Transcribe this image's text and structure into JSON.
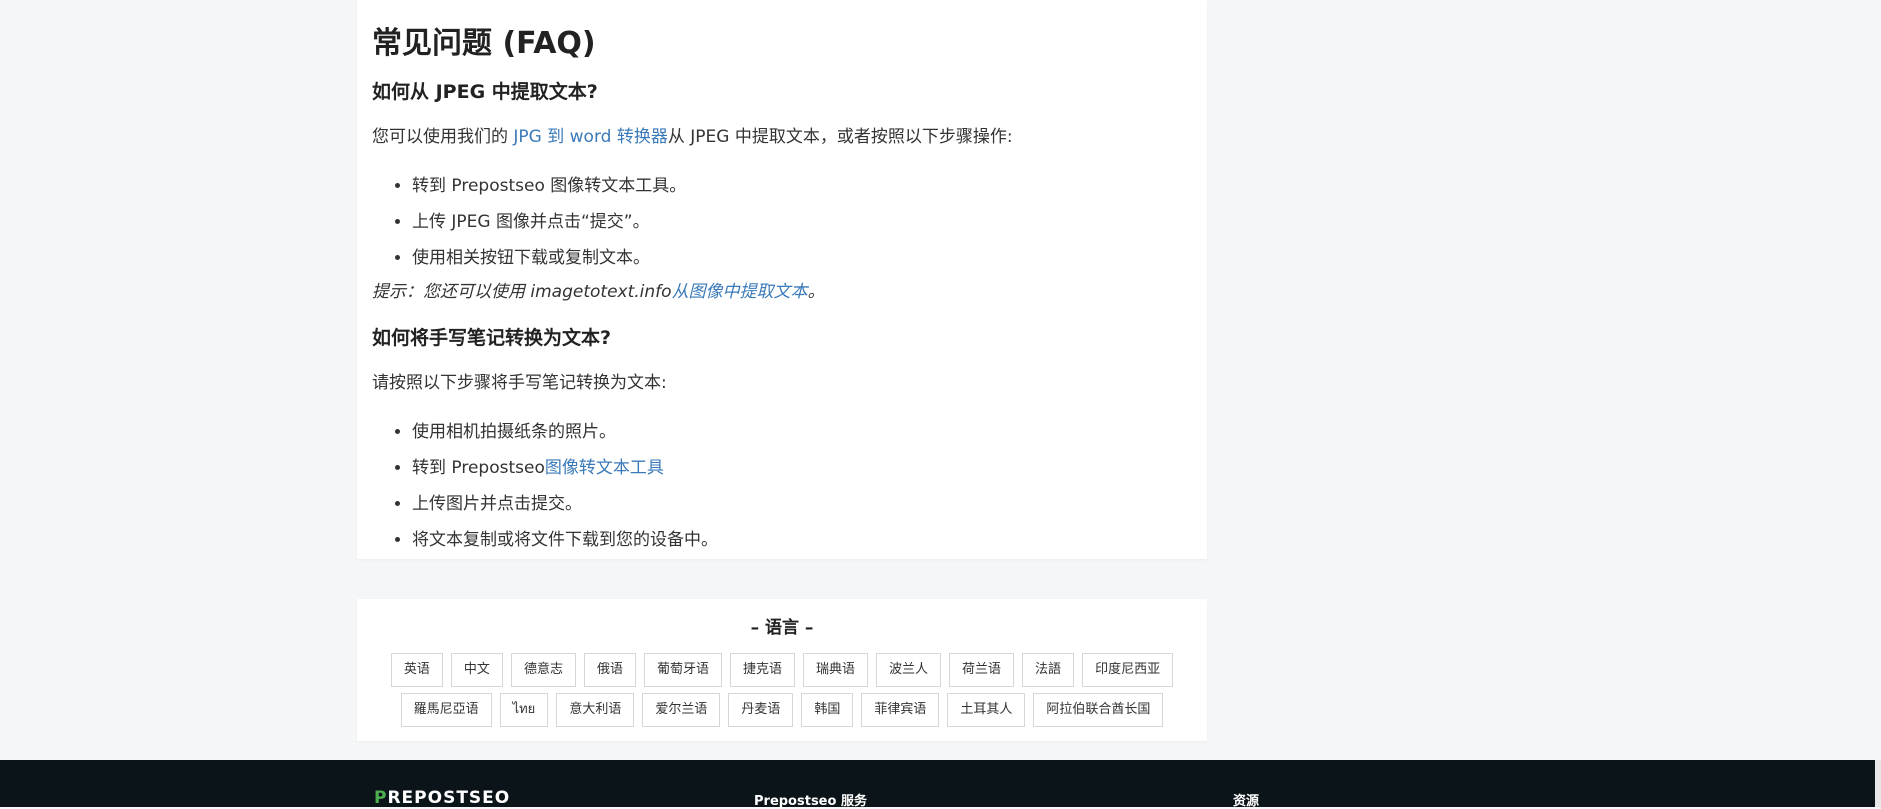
{
  "faq": {
    "title": "常见问题 (FAQ)",
    "q1": {
      "heading": "如何从 JPEG 中提取文本?",
      "intro_before": "您可以使用我们的 ",
      "intro_link": "JPG 到 word 转换器",
      "intro_after": "从 JPEG 中提取文本，或者按照以下步骤操作:",
      "steps": [
        "转到 Prepostseo 图像转文本工具。",
        "上传 JPEG 图像并点击“提交”。",
        "使用相关按钮下载或复制文本。"
      ],
      "tip_before": "提示：您还可以使用 imagetotext.info",
      "tip_link": "从图像中提取文本",
      "tip_after": "。"
    },
    "q2": {
      "heading": "如何将手写笔记转换为文本?",
      "intro": "请按照以下步骤将手写笔记转换为文本:",
      "step1": "使用相机拍摄纸条的照片。",
      "step2_before": "转到 Prepostseo",
      "step2_link": "图像转文本工具",
      "step3": "上传图片并点击提交。",
      "step4": "将文本复制或将文件下载到您的设备中。"
    }
  },
  "languages": {
    "title": "– 语言 –",
    "row1": [
      "英语",
      "中文",
      "德意志",
      "俄语",
      "葡萄牙语",
      "捷克语",
      "瑞典语",
      "波兰人",
      "荷兰语",
      "法語",
      "印度尼西亚"
    ],
    "row2": [
      "羅馬尼亞语",
      "ไทย",
      "意大利语",
      "爱尔兰语",
      "丹麦语",
      "韩国",
      "菲律宾语",
      "土耳其人",
      "阿拉伯联合酋长国"
    ]
  },
  "footer": {
    "logo_p": "P",
    "logo_rest": "REPOSTSEO",
    "heading_services": "Prepostseo 服务",
    "heading_resources": "资源"
  }
}
